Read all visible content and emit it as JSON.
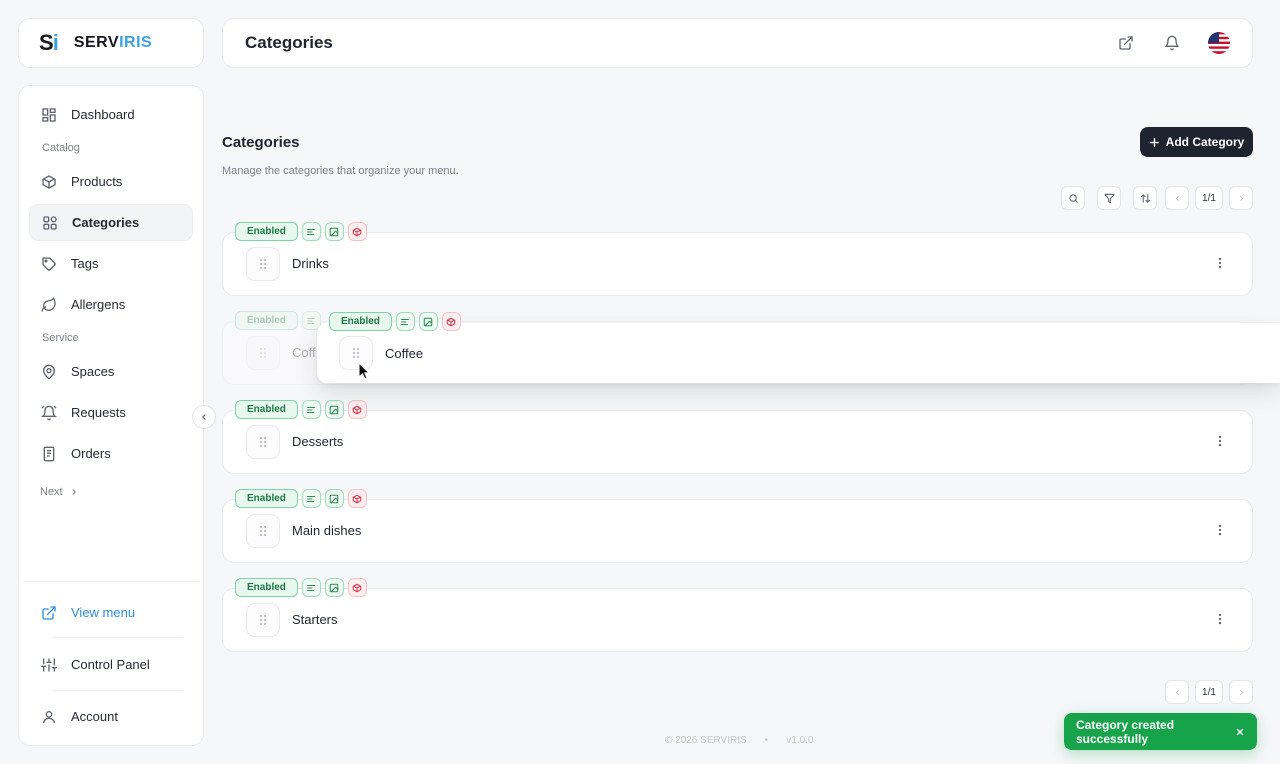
{
  "brand": {
    "mark_s": "S",
    "mark_i": "i",
    "name_a": "SERV",
    "name_b": "IRIS"
  },
  "header": {
    "title": "Categories"
  },
  "sidebar": {
    "items": [
      {
        "label": "Dashboard",
        "icon": "dashboard-icon"
      },
      {
        "label": "Products",
        "icon": "box-icon"
      },
      {
        "label": "Categories",
        "icon": "grid-icon",
        "active": true
      },
      {
        "label": "Tags",
        "icon": "tag-icon"
      },
      {
        "label": "Allergens",
        "icon": "leaf-icon"
      },
      {
        "label": "Spaces",
        "icon": "location-icon"
      },
      {
        "label": "Requests",
        "icon": "bell-icon"
      },
      {
        "label": "Orders",
        "icon": "receipt-icon"
      }
    ],
    "sections": {
      "catalog": "Catalog",
      "service": "Service"
    },
    "next": "Next",
    "bottom": {
      "view_menu": "View menu",
      "control_panel": "Control Panel",
      "account": "Account"
    }
  },
  "main": {
    "title": "Categories",
    "description": "Manage the categories that organize your menu.",
    "add_button": "Add Category",
    "pagination_top": "1/1",
    "pagination_bottom": "1/1",
    "badge_label": "Enabled",
    "rows": [
      {
        "name": "Drinks"
      },
      {
        "name": "Coffee",
        "state": "dragging",
        "ghost_label": "Coff"
      },
      {
        "name": "Desserts"
      },
      {
        "name": "Main dishes"
      },
      {
        "name": "Starters"
      }
    ]
  },
  "footer": {
    "copyright": "© 2026 SERVIRIS",
    "separator": "•",
    "version": "v1.0.0"
  },
  "toast": {
    "message": "Category created successfully"
  },
  "colors": {
    "accent": "#3aa0df",
    "primary_button": "#1e2330",
    "success": "#16a34a",
    "enabled_badge": "#1b7a43",
    "allergen_badge": "#d8344a"
  }
}
